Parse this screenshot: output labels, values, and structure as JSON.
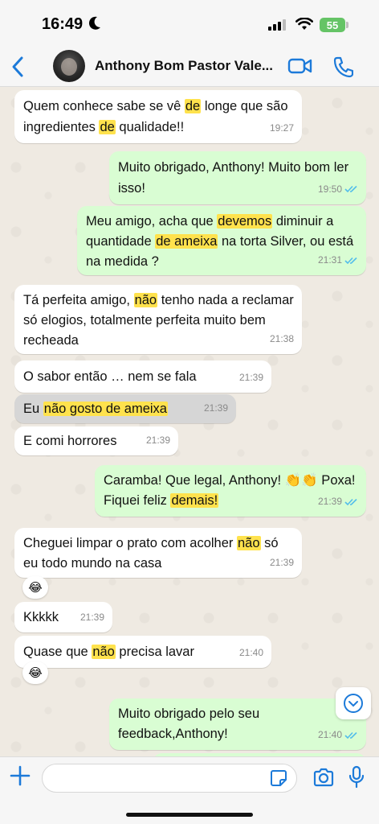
{
  "status": {
    "time": "16:49",
    "battery": "55"
  },
  "header": {
    "contact_name": "Anthony Bom Pastor Vale..."
  },
  "colors": {
    "accent": "#1c7ad9",
    "outgoing_bubble": "#d9fdd3",
    "incoming_bubble": "#ffffff",
    "highlight": "#ffe24d",
    "read_ticks": "#53bdeb"
  },
  "messages": [
    {
      "id": "m1",
      "direction": "in",
      "segments": [
        {
          "t": "Quem conhece sabe se vê "
        },
        {
          "t": "de",
          "hl": true
        },
        {
          "t": " longe que são ingredientes "
        },
        {
          "t": "de",
          "hl": true
        },
        {
          "t": " qualidade!!"
        }
      ],
      "time": "19:27"
    },
    {
      "id": "m2",
      "direction": "out",
      "segments": [
        {
          "t": "Muito obrigado, Anthony! Muito bom ler isso!"
        }
      ],
      "time": "19:50",
      "read": true
    },
    {
      "id": "m3",
      "direction": "out",
      "segments": [
        {
          "t": "Meu amigo, acha que "
        },
        {
          "t": "devemos",
          "hl": true
        },
        {
          "t": " diminuir a quantidade "
        },
        {
          "t": "de ameixa",
          "hl": true
        },
        {
          "t": " na torta Silver, ou está na medida ?"
        }
      ],
      "time": "21:31",
      "read": true
    },
    {
      "id": "m4",
      "direction": "in",
      "segments": [
        {
          "t": "Tá perfeita amigo, "
        },
        {
          "t": "não",
          "hl": true
        },
        {
          "t": " tenho nada a reclamar só elogios, totalmente perfeita muito bem recheada"
        }
      ],
      "time": "21:38"
    },
    {
      "id": "m5",
      "direction": "in",
      "segments": [
        {
          "t": "O sabor então … nem se fala"
        }
      ],
      "time": "21:39"
    },
    {
      "id": "m6",
      "direction": "in",
      "selected": true,
      "segments": [
        {
          "t": "Eu "
        },
        {
          "t": "não gosto de ameixa",
          "hl": true
        }
      ],
      "time": "21:39"
    },
    {
      "id": "m7",
      "direction": "in",
      "segments": [
        {
          "t": "E comi horrores"
        }
      ],
      "time": "21:39"
    },
    {
      "id": "m8",
      "direction": "out",
      "segments": [
        {
          "t": "Caramba! Que legal, Anthony! 👏👏 Poxa! Fiquei feliz "
        },
        {
          "t": "demais!",
          "hl": true
        }
      ],
      "time": "21:39",
      "read": true
    },
    {
      "id": "m9",
      "direction": "in",
      "segments": [
        {
          "t": "Cheguei limpar o prato com acolher "
        },
        {
          "t": "não",
          "hl": true
        },
        {
          "t": " só eu todo mundo na casa"
        }
      ],
      "time": "21:39",
      "reaction": "😂"
    },
    {
      "id": "m10",
      "direction": "in",
      "segments": [
        {
          "t": "Kkkkk"
        }
      ],
      "time": "21:39"
    },
    {
      "id": "m11",
      "direction": "in",
      "segments": [
        {
          "t": "Quase que "
        },
        {
          "t": "não",
          "hl": true
        },
        {
          "t": " precisa lavar"
        }
      ],
      "time": "21:40",
      "reaction": "😂"
    },
    {
      "id": "m12",
      "direction": "out",
      "segments": [
        {
          "t": "Muito obrigado pelo seu feedback,Anthony!"
        }
      ],
      "time": "21:40",
      "read": true
    }
  ],
  "composer": {
    "value": "",
    "placeholder": ""
  }
}
